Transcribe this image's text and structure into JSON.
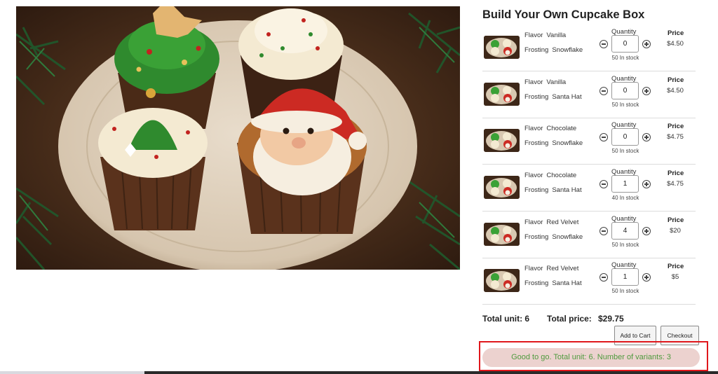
{
  "product": {
    "title": "Build Your Own Cupcake Box",
    "hero_image": "cupcakes-plate-photo"
  },
  "labels": {
    "flavor": "Flavor",
    "frosting": "Frosting",
    "quantity": "Quantity",
    "price": "Price"
  },
  "variants": [
    {
      "flavor": "Vanilla",
      "frosting": "Snowflake",
      "qty": "0",
      "stock": "50 In stock",
      "price": "$4.50"
    },
    {
      "flavor": "Vanilla",
      "frosting": "Santa Hat",
      "qty": "0",
      "stock": "50 In stock",
      "price": "$4.50"
    },
    {
      "flavor": "Chocolate",
      "frosting": "Snowflake",
      "qty": "0",
      "stock": "50 In stock",
      "price": "$4.75"
    },
    {
      "flavor": "Chocolate",
      "frosting": "Santa Hat",
      "qty": "1",
      "stock": "40 In stock",
      "price": "$4.75"
    },
    {
      "flavor": "Red Velvet",
      "frosting": "Snowflake",
      "qty": "4",
      "stock": "50 In stock",
      "price": "$20"
    },
    {
      "flavor": "Red Velvet",
      "frosting": "Santa Hat",
      "qty": "1",
      "stock": "50 In stock",
      "price": "$5"
    }
  ],
  "totals": {
    "unit_text": "Total unit: 6",
    "price_label": "Total price:",
    "price_value": "$29.75"
  },
  "actions": {
    "add_to_cart": "Add to Cart",
    "checkout": "Checkout"
  },
  "status": {
    "message": "Good to go. Total unit: 6. Number of variants: 3"
  },
  "colors": {
    "status_text": "#4f9a3e",
    "status_bg": "#ecd2cf",
    "highlight_border": "#e0171c"
  }
}
